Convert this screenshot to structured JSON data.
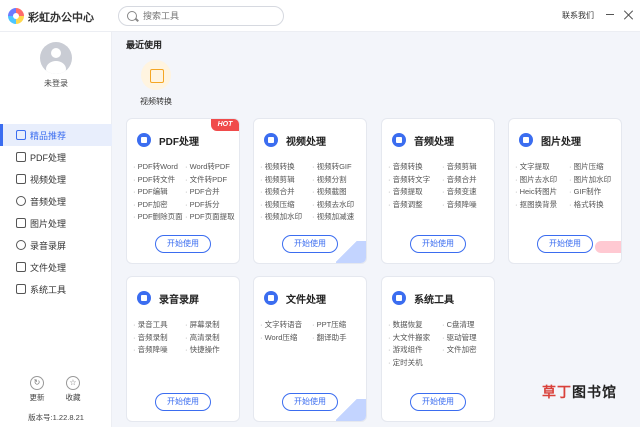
{
  "titlebar": {
    "app_title": "彩虹办公中心",
    "search_placeholder": "搜索工具",
    "contact": "联系我们"
  },
  "user": {
    "status": "未登录"
  },
  "nav": [
    {
      "label": "精品推荐",
      "icon": "thumbs-up-icon",
      "active": true
    },
    {
      "label": "PDF处理",
      "icon": "pdf-icon"
    },
    {
      "label": "视频处理",
      "icon": "video-icon"
    },
    {
      "label": "音频处理",
      "icon": "music-icon"
    },
    {
      "label": "图片处理",
      "icon": "image-icon"
    },
    {
      "label": "录音录屏",
      "icon": "record-icon"
    },
    {
      "label": "文件处理",
      "icon": "folder-icon"
    },
    {
      "label": "系统工具",
      "icon": "system-icon"
    }
  ],
  "sidebar_actions": {
    "update": "更新",
    "favorite": "收藏"
  },
  "version": "版本号:1.22.8.21",
  "recent": {
    "title": "最近使用",
    "items": [
      {
        "label": "视频转换",
        "icon": "video-convert-icon"
      }
    ]
  },
  "cards": [
    {
      "title": "PDF处理",
      "icon": "pdf-icon",
      "color": "#3b6df0",
      "badge": "HOT",
      "col1": [
        "PDF转Word",
        "PDF转文件",
        "PDF编辑",
        "PDF加密",
        "PDF删除页面"
      ],
      "col2": [
        "Word转PDF",
        "文件转PDF",
        "PDF合并",
        "PDF拆分",
        "PDF页面提取"
      ],
      "button": "开始使用"
    },
    {
      "title": "视频处理",
      "icon": "video-icon",
      "color": "#3b6df0",
      "col1": [
        "视频转换",
        "视频剪辑",
        "视频合并",
        "视频压缩",
        "视频加水印"
      ],
      "col2": [
        "视频转GIF",
        "视频分割",
        "视频截图",
        "视频去水印",
        "视频加减速"
      ],
      "button": "开始使用"
    },
    {
      "title": "音频处理",
      "icon": "music-icon",
      "color": "#3b6df0",
      "col1": [
        "音频转换",
        "音频转文字",
        "音频提取",
        "音频调整"
      ],
      "col2": [
        "音频剪辑",
        "音频合并",
        "音频变速",
        "音频降噪"
      ],
      "button": "开始使用"
    },
    {
      "title": "图片处理",
      "icon": "image-icon",
      "color": "#3b6df0",
      "col1": [
        "文字提取",
        "图片去水印",
        "Heic转图片",
        "抠图换背景"
      ],
      "col2": [
        "图片压缩",
        "图片加水印",
        "GIF制作",
        "格式转换"
      ],
      "button": "开始使用"
    },
    {
      "title": "录音录屏",
      "icon": "record-icon",
      "color": "#3b6df0",
      "col1": [
        "录音工具",
        "音频录制",
        "音频降噪"
      ],
      "col2": [
        "屏幕录制",
        "高清录制",
        "快捷操作"
      ],
      "button": "开始使用"
    },
    {
      "title": "文件处理",
      "icon": "folder-icon",
      "color": "#3b6df0",
      "col1": [
        "文字转语音",
        "Word压缩"
      ],
      "col2": [
        "PPT压缩",
        "翻译助手"
      ],
      "button": "开始使用"
    },
    {
      "title": "系统工具",
      "icon": "system-icon",
      "color": "#3b6df0",
      "col1": [
        "数据恢复",
        "大文件搬家",
        "游戏组件",
        "定时关机"
      ],
      "col2": [
        "C盘清理",
        "驱动管理",
        "文件加密"
      ],
      "button": "开始使用"
    }
  ],
  "watermark": {
    "part1": "草丁",
    "part2": "图书馆"
  }
}
